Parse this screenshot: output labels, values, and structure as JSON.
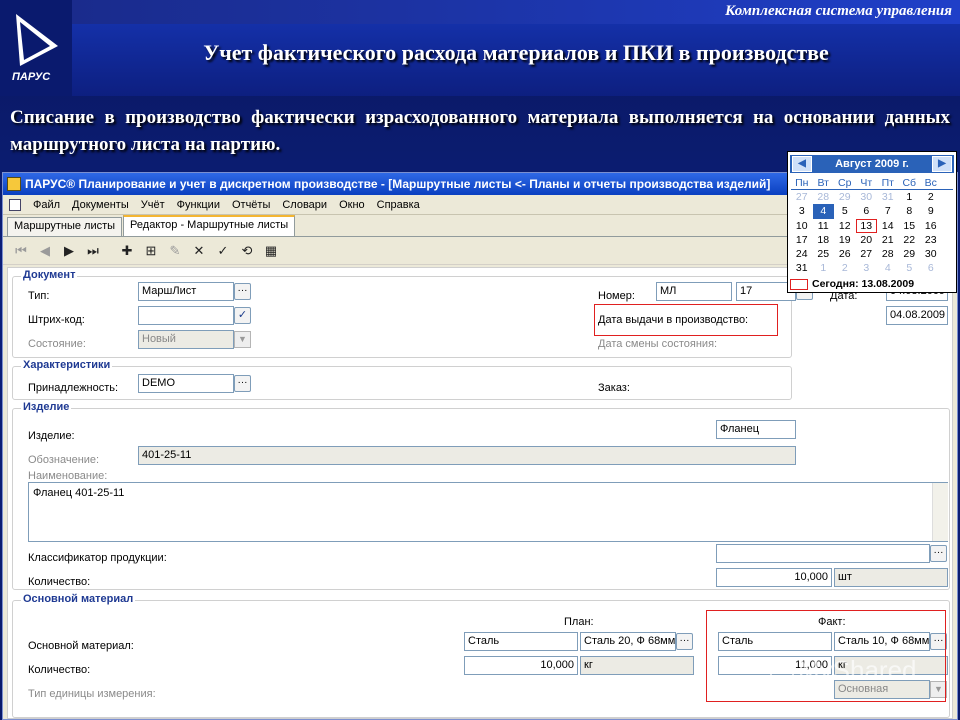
{
  "slide": {
    "system_name": "Комплексная система управления",
    "title": "Учет фактического расхода материалов и ПКИ в производстве",
    "subtitle": "Списание в производство фактически израсходованного материала выполняется на основании данных маршрутного листа на партию.",
    "logo_text": "ПАРУС"
  },
  "window": {
    "title": "ПАРУС® Планирование и учет в дискретном производстве - [Маршрутные листы <- Планы и отчеты производства изделий]",
    "menu": [
      "Файл",
      "Документы",
      "Учёт",
      "Функции",
      "Отчёты",
      "Словари",
      "Окно",
      "Справка"
    ],
    "tabs": [
      "Маршрутные листы",
      "Редактор - Маршрутные листы"
    ]
  },
  "document": {
    "group_title": "Документ",
    "type_label": "Тип:",
    "type_value": "МаршЛист",
    "barcode_label": "Штрих-код:",
    "barcode_value": "",
    "state_label": "Состояние:",
    "state_value": "Новый",
    "number_label": "Номер:",
    "number_prefix": "МЛ",
    "number_value": "17",
    "date_label": "Дата:",
    "date_value": "04.08.2009",
    "issue_date_label": "Дата выдачи в производство:",
    "issue_date_value": "04.08.2009",
    "state_change_label": "Дата смены состояния:"
  },
  "characteristics": {
    "group_title": "Характеристики",
    "belonging_label": "Принадлежность:",
    "belonging_value": "DEMO",
    "order_label": "Заказ:"
  },
  "product": {
    "group_title": "Изделие",
    "product_label": "Изделие:",
    "product_value": "Фланец",
    "designation_label": "Обозначение:",
    "designation_value": "401-25-11",
    "name_label": "Наименование:",
    "name_value": "Фланец 401-25-11",
    "classifier_label": "Классификатор продукции:",
    "classifier_value": "",
    "quantity_label": "Количество:",
    "quantity_value": "10,000",
    "unit": "шт"
  },
  "material": {
    "group_title": "Основной материал",
    "plan_label": "План:",
    "fact_label": "Факт:",
    "material_label": "Основной материал:",
    "quantity_label": "Количество:",
    "unit_type_label": "Тип единицы измерения:",
    "plan_material": "Сталь",
    "plan_grade": "Сталь 20, Ф 68мм",
    "plan_quantity": "10,000",
    "plan_unit": "кг",
    "fact_material": "Сталь",
    "fact_grade": "Сталь 10, Ф 68мм",
    "fact_quantity": "11,000",
    "fact_unit": "кг",
    "unit_type_value": "Основная"
  },
  "calendar": {
    "month_title": "Август 2009 г.",
    "weekdays": [
      "Пн",
      "Вт",
      "Ср",
      "Чт",
      "Пт",
      "Сб",
      "Вс"
    ],
    "weeks": [
      [
        "27",
        "28",
        "29",
        "30",
        "31",
        "1",
        "2"
      ],
      [
        "3",
        "4",
        "5",
        "6",
        "7",
        "8",
        "9"
      ],
      [
        "10",
        "11",
        "12",
        "13",
        "14",
        "15",
        "16"
      ],
      [
        "17",
        "18",
        "19",
        "20",
        "21",
        "22",
        "23"
      ],
      [
        "24",
        "25",
        "26",
        "27",
        "28",
        "29",
        "30"
      ],
      [
        "31",
        "1",
        "2",
        "3",
        "4",
        "5",
        "6"
      ]
    ],
    "today_label": "Сегодня: 13.08.2009"
  },
  "watermark": "MyShared"
}
